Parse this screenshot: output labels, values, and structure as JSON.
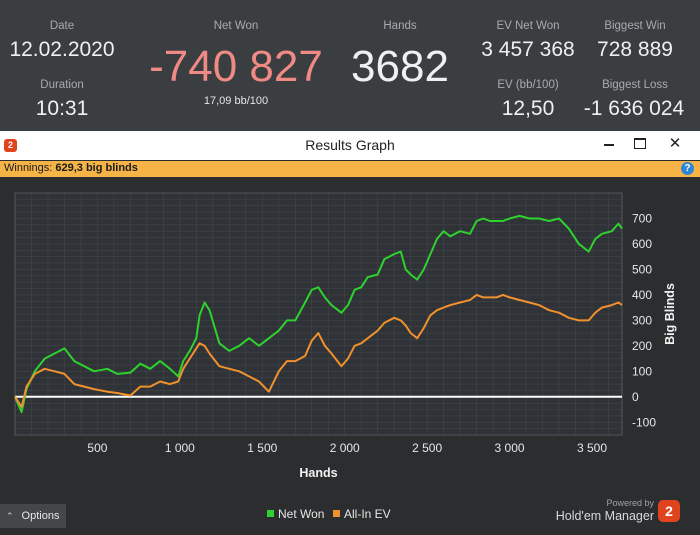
{
  "stats": {
    "date_label": "Date",
    "date": "12.02.2020",
    "duration_label": "Duration",
    "duration": "10:31",
    "net_won_label": "Net Won",
    "net_won": "-740 827",
    "bb_per_100": "17,09 bb/100",
    "hands_label": "Hands",
    "hands": "3682",
    "ev_net_won_label": "EV Net Won",
    "ev_net_won": "3 457 368",
    "ev_bb_label": "EV (bb/100)",
    "ev_bb": "12,50",
    "biggest_win_label": "Biggest Win",
    "biggest_win": "728 889",
    "biggest_loss_label": "Biggest Loss",
    "biggest_loss": "-1 636 024"
  },
  "window": {
    "title": "Results Graph",
    "winnings_label": "Winnings:",
    "winnings_value": "629,3 big blinds",
    "minimize_glyph": "",
    "close_glyph": "✕",
    "help_glyph": "?"
  },
  "options": {
    "label": "Options",
    "chevron": "⌃"
  },
  "powered": {
    "text": "Powered by",
    "brand": "Hold'em Manager",
    "logo": "2"
  },
  "chart_data": {
    "type": "line",
    "xlabel": "Hands",
    "ylabel": "Big Blinds",
    "xlim": [
      0,
      3682
    ],
    "ylim": [
      -150,
      800
    ],
    "x_ticks": [
      500,
      1000,
      1500,
      2000,
      2500,
      3000,
      3500
    ],
    "x_tick_labels": [
      "500",
      "1 000",
      "1 500",
      "2 000",
      "2 500",
      "3 000",
      "3 500"
    ],
    "y_ticks": [
      -100,
      0,
      100,
      200,
      300,
      400,
      500,
      600,
      700
    ],
    "grid": true,
    "legend_position": "bottom-center",
    "colors": {
      "net_won": "#2ed12e",
      "all_in_ev": "#f0912e",
      "zero_line": "#ffffff",
      "grid": "#4a4d51"
    },
    "series": [
      {
        "name": "Net Won",
        "x": [
          0,
          40,
          70,
          120,
          180,
          240,
          300,
          360,
          420,
          480,
          560,
          620,
          700,
          760,
          820,
          880,
          940,
          990,
          1020,
          1060,
          1100,
          1120,
          1150,
          1180,
          1240,
          1300,
          1360,
          1420,
          1480,
          1540,
          1600,
          1650,
          1700,
          1760,
          1800,
          1840,
          1880,
          1920,
          1980,
          2020,
          2060,
          2100,
          2140,
          2200,
          2240,
          2300,
          2340,
          2370,
          2400,
          2440,
          2480,
          2520,
          2560,
          2600,
          2640,
          2700,
          2760,
          2800,
          2840,
          2880,
          2920,
          2960,
          3000,
          3060,
          3120,
          3180,
          3240,
          3300,
          3360,
          3420,
          3480,
          3520,
          3560,
          3620,
          3660,
          3682
        ],
        "values": [
          0,
          -60,
          30,
          100,
          150,
          170,
          190,
          140,
          120,
          100,
          110,
          90,
          95,
          130,
          110,
          140,
          110,
          80,
          140,
          180,
          230,
          320,
          370,
          340,
          210,
          180,
          200,
          230,
          200,
          230,
          260,
          300,
          300,
          370,
          420,
          430,
          390,
          360,
          330,
          360,
          420,
          430,
          470,
          480,
          540,
          560,
          570,
          500,
          480,
          460,
          500,
          560,
          620,
          650,
          630,
          650,
          640,
          690,
          700,
          690,
          690,
          690,
          700,
          710,
          700,
          700,
          690,
          700,
          660,
          600,
          570,
          620,
          640,
          650,
          680,
          660
        ]
      },
      {
        "name": "All-In EV",
        "x": [
          0,
          40,
          70,
          120,
          180,
          240,
          300,
          360,
          420,
          480,
          560,
          620,
          700,
          760,
          820,
          880,
          940,
          990,
          1020,
          1060,
          1100,
          1120,
          1150,
          1180,
          1240,
          1300,
          1360,
          1420,
          1480,
          1540,
          1600,
          1650,
          1700,
          1760,
          1800,
          1840,
          1880,
          1920,
          1980,
          2020,
          2060,
          2100,
          2140,
          2200,
          2240,
          2300,
          2340,
          2370,
          2400,
          2440,
          2480,
          2520,
          2560,
          2600,
          2640,
          2700,
          2760,
          2800,
          2840,
          2880,
          2920,
          2960,
          3000,
          3060,
          3120,
          3180,
          3240,
          3300,
          3360,
          3420,
          3480,
          3520,
          3560,
          3620,
          3660,
          3682
        ],
        "values": [
          0,
          -40,
          40,
          90,
          110,
          100,
          90,
          50,
          40,
          30,
          20,
          15,
          5,
          40,
          40,
          60,
          50,
          60,
          110,
          150,
          190,
          210,
          200,
          170,
          120,
          110,
          100,
          80,
          60,
          20,
          100,
          140,
          140,
          160,
          220,
          250,
          200,
          170,
          120,
          150,
          200,
          210,
          230,
          260,
          290,
          310,
          300,
          280,
          250,
          230,
          270,
          320,
          340,
          350,
          360,
          370,
          380,
          400,
          390,
          390,
          390,
          400,
          390,
          380,
          370,
          360,
          340,
          330,
          310,
          300,
          300,
          330,
          350,
          360,
          370,
          360
        ]
      }
    ]
  }
}
